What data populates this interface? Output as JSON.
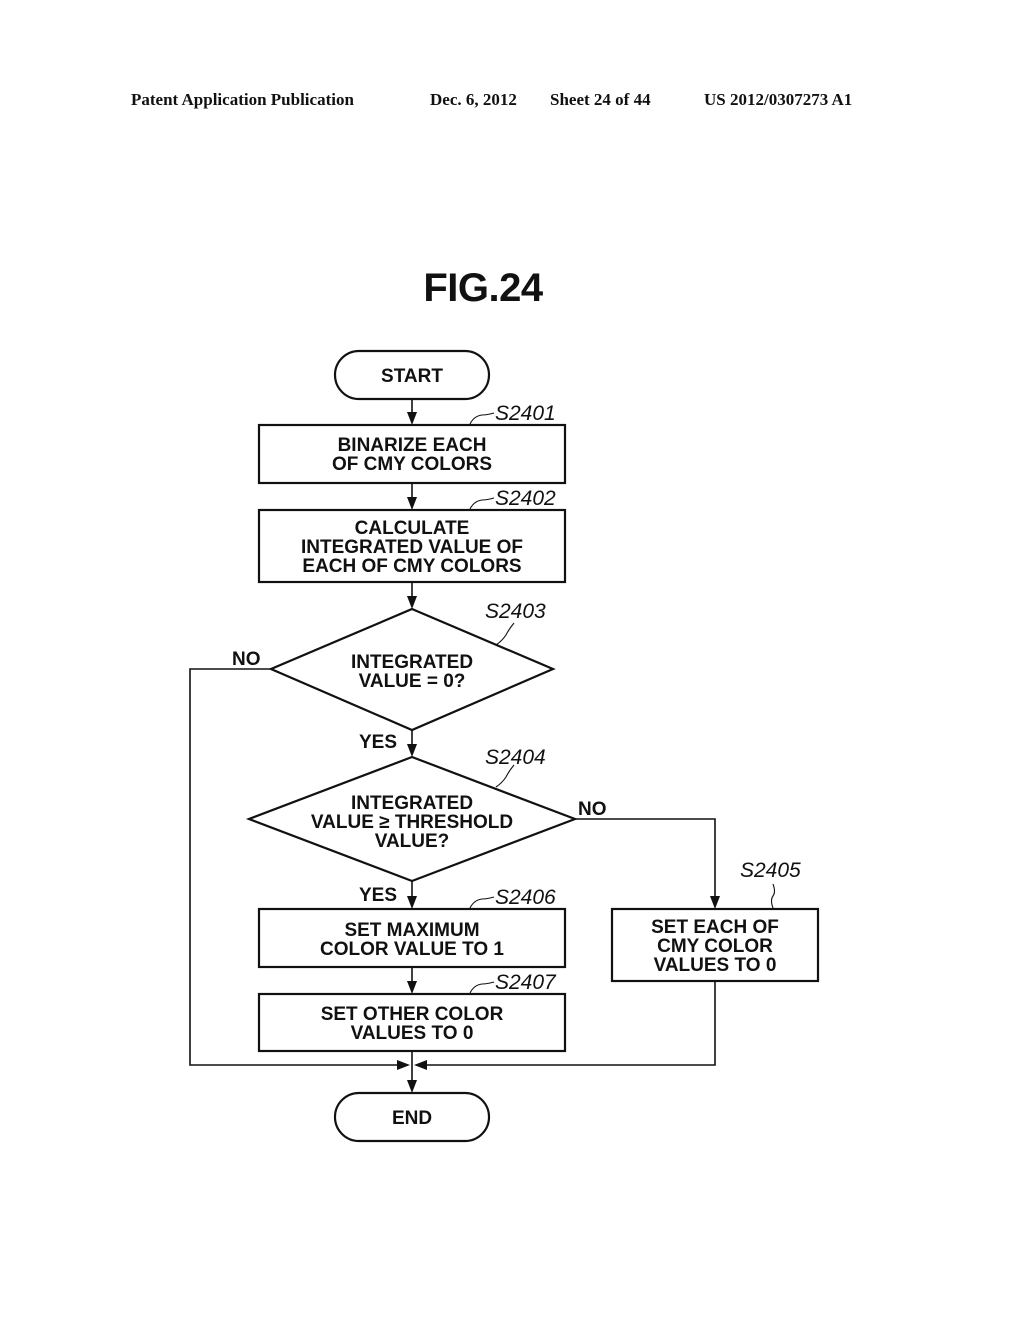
{
  "header": {
    "publication": "Patent Application Publication",
    "date": "Dec. 6, 2012",
    "sheet": "Sheet 24 of 44",
    "number": "US 2012/0307273 A1"
  },
  "figure": {
    "title": "FIG.24"
  },
  "flowchart": {
    "start": "START",
    "end": "END",
    "steps": {
      "s2401": {
        "id": "S2401",
        "lines": [
          "BINARIZE EACH",
          "OF CMY COLORS"
        ]
      },
      "s2402": {
        "id": "S2402",
        "lines": [
          "CALCULATE",
          "INTEGRATED VALUE OF",
          "EACH OF CMY COLORS"
        ]
      },
      "s2403": {
        "id": "S2403",
        "lines": [
          "INTEGRATED",
          "VALUE = 0?"
        ]
      },
      "s2404": {
        "id": "S2404",
        "lines": [
          "INTEGRATED",
          "VALUE ≥ THRESHOLD",
          "VALUE?"
        ]
      },
      "s2405": {
        "id": "S2405",
        "lines": [
          "SET EACH OF",
          "CMY COLOR",
          "VALUES TO 0"
        ]
      },
      "s2406": {
        "id": "S2406",
        "lines": [
          "SET MAXIMUM",
          "COLOR VALUE TO 1"
        ]
      },
      "s2407": {
        "id": "S2407",
        "lines": [
          "SET OTHER COLOR",
          "VALUES TO 0"
        ]
      }
    },
    "branches": {
      "s2403_no": "NO",
      "s2403_yes": "YES",
      "s2404_no": "NO",
      "s2404_yes": "YES"
    }
  }
}
